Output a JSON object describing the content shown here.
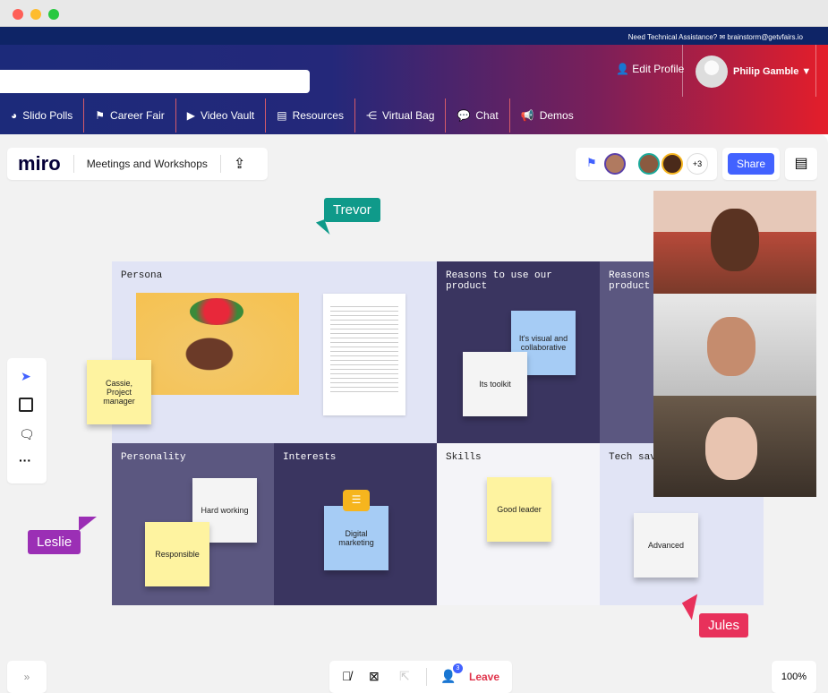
{
  "window": {
    "controls": [
      "close",
      "minimize",
      "maximize"
    ]
  },
  "topbar": {
    "assistance": "Need Technical Assistance? ✉ brainstorm@getvfairs.io"
  },
  "header": {
    "search_placeholder": "",
    "edit_profile": "Edit Profile",
    "user_name": "Philip Gamble ▼"
  },
  "nav": [
    {
      "icon": "pie-chart-icon",
      "glyph": "◕",
      "label": "Slido Polls"
    },
    {
      "icon": "flag-icon",
      "glyph": "⚑",
      "label": "Career Fair"
    },
    {
      "icon": "video-icon",
      "glyph": "▶",
      "label": "Video Vault"
    },
    {
      "icon": "pdf-icon",
      "glyph": "▤",
      "label": "Resources"
    },
    {
      "icon": "share-icon",
      "glyph": "⋲",
      "label": "Virtual Bag"
    },
    {
      "icon": "chat-icon",
      "glyph": "💬",
      "label": "Chat"
    },
    {
      "icon": "megaphone-icon",
      "glyph": "📢",
      "label": "Demos"
    }
  ],
  "miro": {
    "logo": "miro",
    "board_title": "Meetings and Workshops",
    "more_count": "+3",
    "share": "Share",
    "zoom": "100%",
    "leave": "Leave",
    "participants_badge": "3",
    "expand": "»"
  },
  "board": {
    "cells": [
      "Persona",
      "Reasons to use our product",
      "Reasons to use our product",
      "Personality",
      "Interests",
      "Skills",
      "Tech savvy"
    ],
    "stickies": [
      "Cassie, Project manager",
      "It's visual and collaborative",
      "Its toolkit",
      "Hard working",
      "Responsible",
      "Digital marketing",
      "Good leader",
      "Advanced"
    ],
    "cursors": [
      "Trevor",
      "Leslie",
      "Jules"
    ]
  },
  "colors": {
    "share": "#4262ff",
    "trevor": "#0f9a8a",
    "leslie": "#9b2fb5",
    "jules": "#e8315b",
    "leave": "#e0344b"
  }
}
